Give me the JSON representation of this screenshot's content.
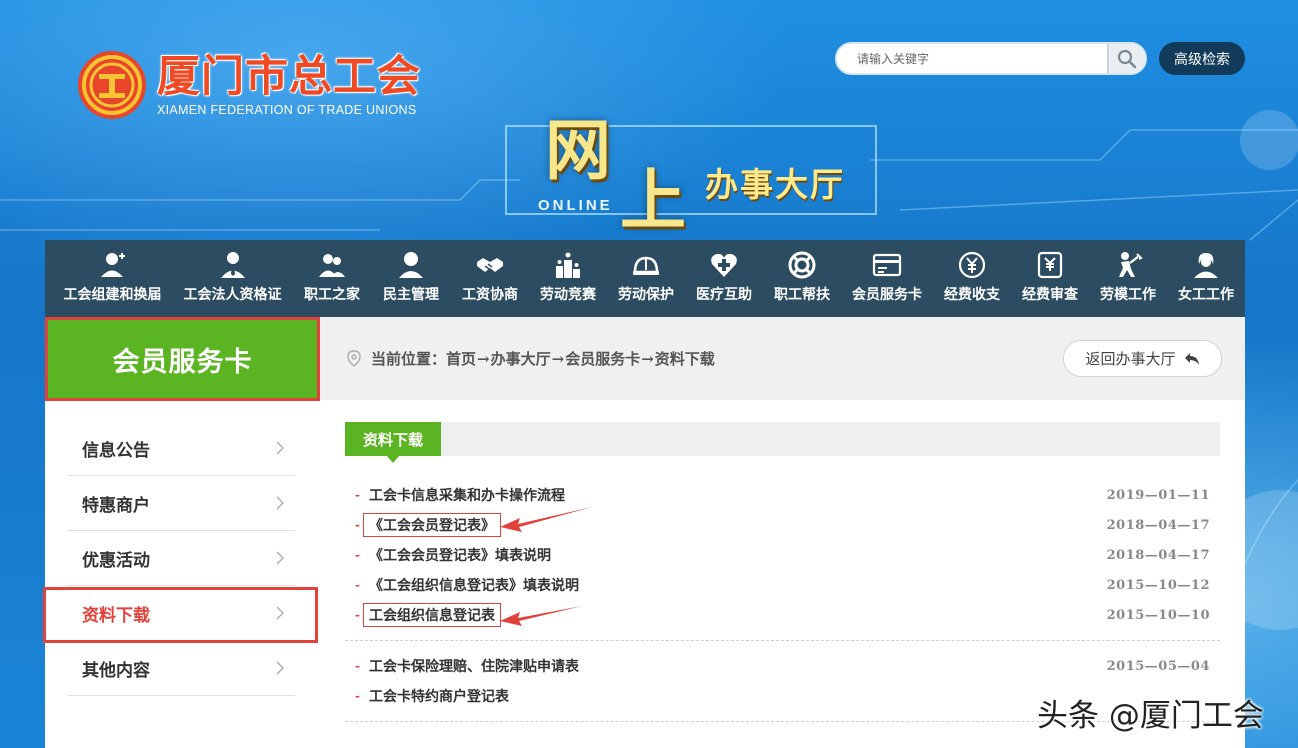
{
  "brand": {
    "name_cn": "厦门市总工会",
    "name_en": "XIAMEN FEDERATION OF TRADE UNIONS"
  },
  "search": {
    "placeholder": "请输入关键字",
    "advanced_label": "高级检索"
  },
  "banner": {
    "online": "ONLINE",
    "char1": "网",
    "char2": "上",
    "subtitle": "办事大厅"
  },
  "nav": {
    "items": [
      {
        "label": "工会组建和换届",
        "icon": "user-add-icon"
      },
      {
        "label": "工会法人资格证",
        "icon": "person-tie-icon"
      },
      {
        "label": "职工之家",
        "icon": "worker-group-icon"
      },
      {
        "label": "民主管理",
        "icon": "person-icon"
      },
      {
        "label": "工资协商",
        "icon": "handshake-icon"
      },
      {
        "label": "劳动竞赛",
        "icon": "podium-icon"
      },
      {
        "label": "劳动保护",
        "icon": "hardhat-icon"
      },
      {
        "label": "医疗互助",
        "icon": "medical-heart-icon"
      },
      {
        "label": "职工帮扶",
        "icon": "lifebuoy-icon"
      },
      {
        "label": "会员服务卡",
        "icon": "card-icon"
      },
      {
        "label": "经费收支",
        "icon": "yuan-coin-icon"
      },
      {
        "label": "经费审查",
        "icon": "yuan-audit-icon"
      },
      {
        "label": "劳模工作",
        "icon": "laborer-icon"
      },
      {
        "label": "女工工作",
        "icon": "woman-icon"
      }
    ]
  },
  "sidebar": {
    "title": "会员服务卡",
    "items": [
      {
        "label": "信息公告"
      },
      {
        "label": "特惠商户"
      },
      {
        "label": "优惠活动"
      },
      {
        "label": "资料下载"
      },
      {
        "label": "其他内容"
      }
    ],
    "active_index": 3
  },
  "breadcrumb": {
    "prefix": "当前位置：",
    "parts": [
      "首页",
      "办事大厅",
      "会员服务卡",
      "资料下载"
    ],
    "separator": "→"
  },
  "back_button": "返回办事大厅",
  "section": {
    "title": "资料下载"
  },
  "documents": {
    "group1": [
      {
        "title": "工会卡信息采集和办卡操作流程",
        "date": "2019—01—11"
      },
      {
        "title": "《工会会员登记表》",
        "date": "2018—04—17"
      },
      {
        "title": "《工会会员登记表》填表说明",
        "date": "2018—04—17"
      },
      {
        "title": "《工会组织信息登记表》填表说明",
        "date": "2015—10—12"
      },
      {
        "title": "工会组织信息登记表",
        "date": "2015—10—10"
      }
    ],
    "group2": [
      {
        "title": "工会卡保险理赔、住院津贴申请表",
        "date": "2015—05—04"
      },
      {
        "title": "工会卡特约商户登记表",
        "date": ""
      }
    ]
  },
  "watermark": "头条 @厦门工会",
  "colors": {
    "brand_red": "#e2423c",
    "green": "#5bb422",
    "nav_bg": "#2c4c62",
    "sky_blue": "#1a86d8"
  }
}
